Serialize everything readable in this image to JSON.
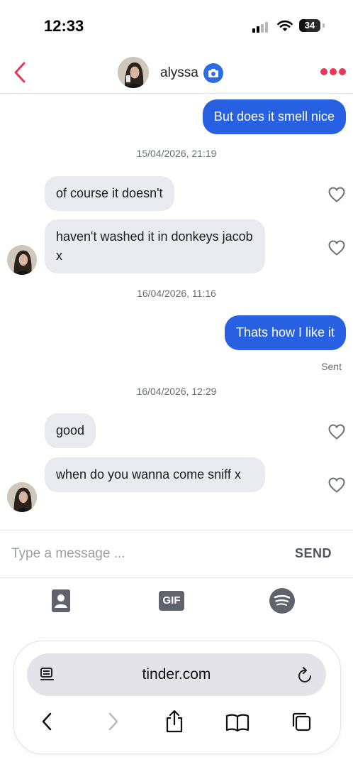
{
  "status_bar": {
    "time": "12:33",
    "battery": "34"
  },
  "header": {
    "contact_name": "alyssa"
  },
  "messages": [
    {
      "direction": "out",
      "text": "But does it smell nice"
    },
    {
      "type": "timestamp",
      "text": "15/04/2026, 21:19"
    },
    {
      "direction": "in",
      "text": "of course it doesn't"
    },
    {
      "direction": "in",
      "text": "haven't washed it in donkeys jacob x"
    },
    {
      "type": "timestamp",
      "text": "16/04/2026, 11:16"
    },
    {
      "direction": "out",
      "text": "Thats how I like it"
    },
    {
      "type": "status",
      "text": "Sent"
    },
    {
      "type": "timestamp",
      "text": "16/04/2026, 12:29"
    },
    {
      "direction": "in",
      "text": "good"
    },
    {
      "direction": "in",
      "text": "when do you wanna come sniff x"
    }
  ],
  "composer": {
    "placeholder": "Type a message ...",
    "send_label": "SEND"
  },
  "attachments": {
    "gif_label": "GIF"
  },
  "browser": {
    "url": "tinder.com"
  },
  "colors": {
    "accent": "#2760e0",
    "brand": "#e8385a",
    "incoming_bubble": "#e9eaee"
  },
  "icons": [
    "signal-icon",
    "wifi-icon",
    "battery-icon",
    "back-chevron-icon",
    "camera-icon",
    "more-dots-icon",
    "heart-icon",
    "contact-card-icon",
    "gif-icon",
    "spotify-icon",
    "reader-icon",
    "reload-icon",
    "share-icon",
    "bookmarks-icon",
    "tabs-icon"
  ]
}
